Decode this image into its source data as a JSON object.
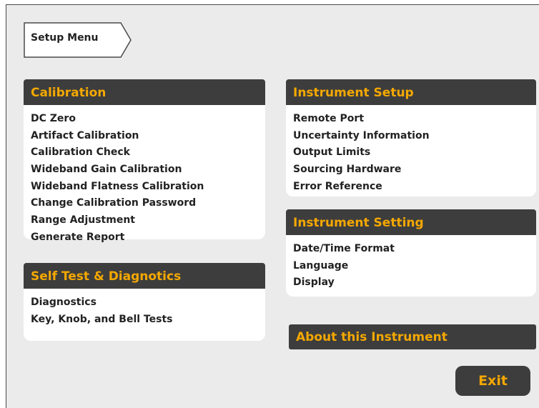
{
  "breadcrumb": {
    "label": "Setup Menu"
  },
  "calibration": {
    "title": "Calibration",
    "items": [
      "DC Zero",
      "Artifact Calibration",
      "Calibration Check",
      "Wideband Gain Calibration",
      "Wideband Flatness Calibration",
      "Change Calibration Password",
      "Range Adjustment",
      "Generate Report"
    ]
  },
  "self_test": {
    "title": "Self Test & Diagnotics",
    "items": [
      "Diagnostics",
      "Key, Knob, and Bell Tests"
    ]
  },
  "instrument_setup": {
    "title": "Instrument Setup",
    "items": [
      "Remote Port",
      "Uncertainty Information",
      "Output Limits",
      "Sourcing Hardware",
      "Error Reference"
    ]
  },
  "instrument_setting": {
    "title": "Instrument Setting",
    "items": [
      "Date/Time Format",
      "Language",
      "Display"
    ]
  },
  "about": {
    "label": "About this Instrument"
  },
  "exit": {
    "label": "Exit"
  },
  "colors": {
    "background": "#ebebeb",
    "header": "#3d3d3d",
    "accent": "#f5a800",
    "panel": "#ffffff",
    "text": "#222222"
  }
}
